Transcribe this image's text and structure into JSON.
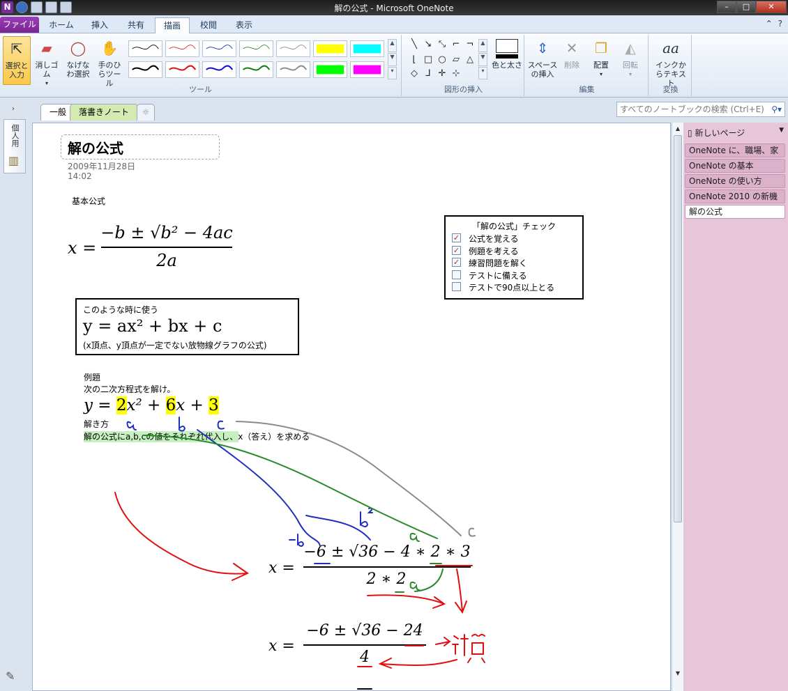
{
  "window": {
    "title": "解の公式 - Microsoft OneNote",
    "app_icon_label": "N",
    "minimize": "–",
    "maximize": "□",
    "close": "✕"
  },
  "ribbon_tabs": {
    "file": "ファイル",
    "home": "ホーム",
    "insert": "挿入",
    "share": "共有",
    "draw": "描画",
    "review": "校閲",
    "view": "表示",
    "help_icon": "?"
  },
  "ribbon": {
    "select_label": "選択と入力",
    "eraser_label": "消しゴム",
    "lasso_label": "なげなわ選択",
    "pan_label": "手のひらツール",
    "tools_group": "ツール",
    "color_thickness_label": "色と太さ",
    "insert_shapes_group": "図形の挿入",
    "insert_space_label": "スペースの挿入",
    "delete_label": "削除",
    "arrange_label": "配置",
    "rotate_label": "回転",
    "edit_group": "編集",
    "ink_to_text_label": "インクからテキスト",
    "convert_group": "変換",
    "pen_colors_top": [
      "#000000",
      "#d42a2a",
      "#1f2fbd",
      "#2a8a2a",
      "#8a8a8a",
      "#ffff00",
      "#00ffff"
    ],
    "pen_colors_bottom": [
      "#000000",
      "#e01010",
      "#1010d0",
      "#108010",
      "#909090",
      "#00ff00",
      "#ff00ff"
    ]
  },
  "navigation": {
    "notebook_label": "個人用"
  },
  "sections": {
    "tab1": "一般",
    "tab2": "落書きノート",
    "tab3": "☼"
  },
  "search": {
    "placeholder": "すべてのノートブックの検索 (Ctrl+E)"
  },
  "pages": {
    "new_page": "新しいページ",
    "items": [
      "OneNote に、職場、家",
      "OneNote の基本",
      "OneNote の使い方",
      "OneNote 2010 の新機",
      "解の公式"
    ]
  },
  "note": {
    "title": "解の公式",
    "date": "2009年11月28日",
    "time": "14:02",
    "basic_formula_label": "基本公式",
    "formula_lhs": "x =",
    "formula_numerator": "−b ± √b² − 4ac",
    "formula_denominator": "2a",
    "usage_title": "このような時に使う",
    "usage_equation": "y = ax² + bx + c",
    "usage_note": "(x頂点、y頂点が一定でない放物線グラフの公式)",
    "checklist_title": "「解の公式」チェック",
    "checklist": [
      {
        "label": "公式を覚える",
        "checked": true
      },
      {
        "label": "例題を考える",
        "checked": true
      },
      {
        "label": "練習問題を解く",
        "checked": true
      },
      {
        "label": "テストに備える",
        "checked": false
      },
      {
        "label": "テストで90点以上とる",
        "checked": false
      }
    ],
    "example_label": "例題",
    "example_prompt": "次の二次方程式を解け。",
    "example_eq_y": "y = ",
    "example_a": "2",
    "example_x2": "x² + ",
    "example_b": "6",
    "example_x": "x + ",
    "example_c": "3",
    "method_label": "解き方",
    "method_text": "解の公式にa,b,cの値をそれぞれ代入し、x（答え）を求める",
    "step1_lhs": "x =",
    "step1_numerator": "−6 ± √36 − 4 ∗ 2 ∗ 3",
    "step1_denominator": "2 ∗ 2",
    "step2_lhs": "x =",
    "step2_numerator": "−6 ± √36 − 24",
    "step2_denominator": "4"
  }
}
